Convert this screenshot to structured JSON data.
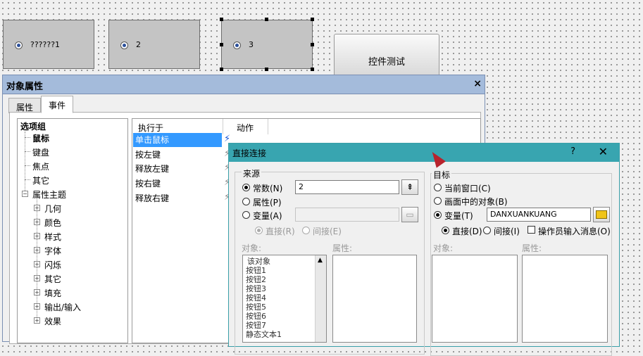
{
  "canvas": {
    "radio_boxes": [
      {
        "label": "??????1"
      },
      {
        "label": "2"
      },
      {
        "label": "3"
      }
    ],
    "test_button": "控件测试"
  },
  "prop_window": {
    "title": "对象属性",
    "close": "×",
    "tabs": [
      "属性",
      "事件"
    ],
    "active_tab": "事件",
    "tree": {
      "root": "选项组",
      "items": [
        "鼠标",
        "键盘",
        "焦点",
        "其它"
      ],
      "theme": "属性主题",
      "theme_items": [
        "几何",
        "颜色",
        "样式",
        "字体",
        "闪烁",
        "其它",
        "填充",
        "输出/输入",
        "效果"
      ]
    },
    "events": {
      "col_exec": "执行于",
      "col_action": "动作",
      "rows": [
        "单击鼠标",
        "按左键",
        "释放左键",
        "按右键",
        "释放右键"
      ],
      "selected": "单击鼠标"
    }
  },
  "dialog": {
    "title": "直接连接",
    "help": "?",
    "close": "✕",
    "source": {
      "label": "来源",
      "const_label": "常数(N)",
      "const_value": "2",
      "prop_label": "属性(P)",
      "var_label": "变量(A)",
      "var_value": "",
      "direct": "直接(R)",
      "indirect": "间接(E)",
      "obj_label": "对象:",
      "attr_label": "属性:",
      "objects": [
        "该对象",
        "按钮1",
        "按钮2",
        "按钮3",
        "按钮4",
        "按钮5",
        "按钮6",
        "按钮7",
        "静态文本1"
      ]
    },
    "target": {
      "label": "目标",
      "cur_window": "当前窗口(C)",
      "obj_in_screen": "画面中的对象(B)",
      "var_label": "变量(T)",
      "var_value": "DANXUANKUANG",
      "direct": "直接(D)",
      "indirect": "间接(I)",
      "operator_msg": "操作员输入消息(O)",
      "obj_label": "对象:",
      "attr_label": "属性:"
    }
  }
}
